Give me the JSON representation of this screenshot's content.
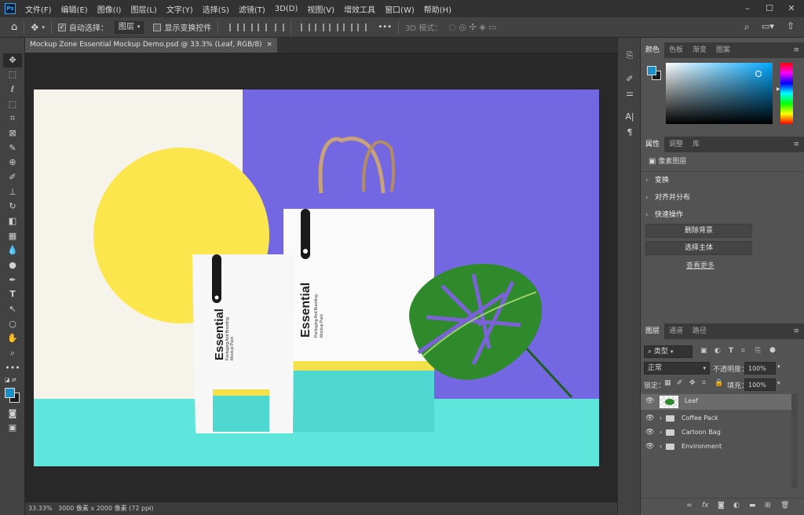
{
  "app": {
    "logo": "Ps",
    "menus": [
      "文件(F)",
      "编辑(E)",
      "图像(I)",
      "图层(L)",
      "文字(Y)",
      "选择(S)",
      "滤镜(T)",
      "3D(D)",
      "视图(V)",
      "增效工具",
      "窗口(W)",
      "帮助(H)"
    ]
  },
  "options": {
    "auto_select_label": "自动选择：",
    "auto_select_target": "图层",
    "show_transform_label": "显示变换控件",
    "more": "•••",
    "mode_3d": "3D 模式："
  },
  "document": {
    "tab_title": "Mockup Zone Essential Mockup Demo.psd @ 33.3% (Leaf, RGB/8)",
    "close": "×",
    "zoom": "33.33%",
    "info": "3000 像素 x 2000 像素 (72 ppi)",
    "info_arrow": "›"
  },
  "artwork": {
    "pouch_title": "Essential",
    "pouch_sub": "Packaging And Branding",
    "pouch_sub2": "Mockup Pack",
    "bag_title": "Essential",
    "bag_sub": "Packaging And Branding",
    "bag_sub2": "Mockup Pack"
  },
  "color_panel": {
    "tabs": [
      "颜色",
      "色板",
      "渐变",
      "图案"
    ],
    "fg": "#1b8fc9",
    "bg": "#1a1a1a"
  },
  "properties_panel": {
    "tabs": [
      "属性",
      "调整",
      "库"
    ],
    "layer_type": "像素图层",
    "sections": [
      "变换",
      "对齐并分布",
      "快速操作"
    ],
    "buttons": [
      "删除背景",
      "选择主体"
    ],
    "more_link": "查看更多"
  },
  "layers_panel": {
    "tabs": [
      "图层",
      "通道",
      "路径"
    ],
    "filter": "类型",
    "blend_mode": "正常",
    "opacity_label": "不透明度：",
    "opacity": "100%",
    "lock_label": "锁定：",
    "fill_label": "填充：",
    "fill": "100%",
    "layers": [
      {
        "name": "Leaf",
        "type": "pixel",
        "selected": true
      },
      {
        "name": "Coffee Pack",
        "type": "group"
      },
      {
        "name": "Cartoon Bag",
        "type": "group"
      },
      {
        "name": "Environment",
        "type": "group"
      }
    ]
  },
  "colors": {
    "accent": "#31a8ff",
    "purple": "#7367e2",
    "yellow": "#fbe74d",
    "cyan": "#5ee6dc",
    "cream": "#f5f3ea"
  }
}
